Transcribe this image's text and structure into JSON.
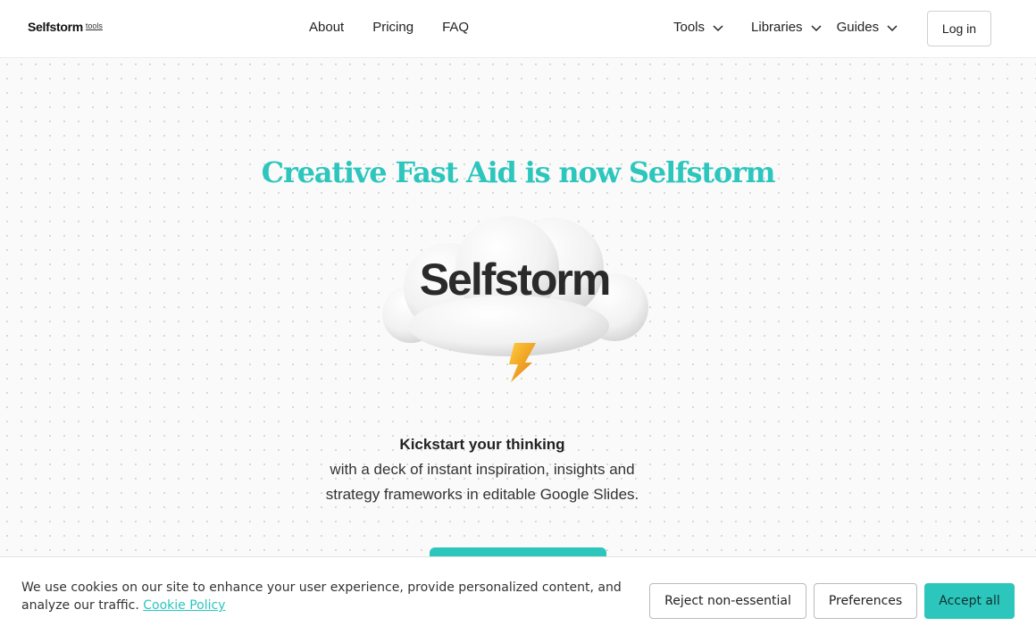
{
  "nav": {
    "logo": {
      "main": "Selfstorm",
      "sub": "tools"
    },
    "links": [
      "About",
      "Pricing",
      "FAQ"
    ],
    "dropdowns": [
      "Tools",
      "Libraries",
      "Guides"
    ],
    "login": "Log in"
  },
  "hero": {
    "headline": "Creative Fast Aid is now Selfstorm",
    "brand": "Selfstorm",
    "tagline_strong": "Kickstart your thinking",
    "tagline": "with a deck of instant inspiration, insights and strategy frameworks in editable Google Slides."
  },
  "cookie": {
    "text": "We use cookies on our site to enhance your user experience, provide personalized content, and analyze our traffic.",
    "link": "Cookie Policy",
    "reject": "Reject non-essential",
    "preferences": "Preferences",
    "accept": "Accept all"
  },
  "colors": {
    "accent": "#2cc6bd",
    "text": "#222222",
    "background": "#fafafa"
  }
}
